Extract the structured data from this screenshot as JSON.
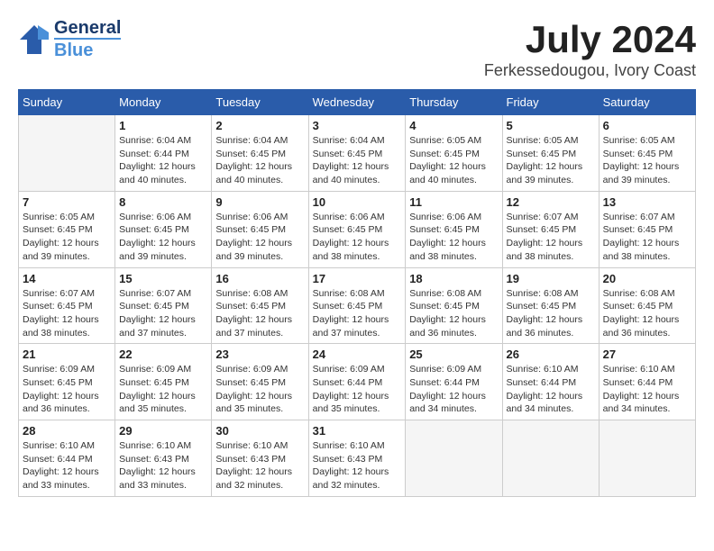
{
  "logo": {
    "general": "General",
    "blue": "Blue"
  },
  "title": {
    "month_year": "July 2024",
    "location": "Ferkessedougou, Ivory Coast"
  },
  "headers": [
    "Sunday",
    "Monday",
    "Tuesday",
    "Wednesday",
    "Thursday",
    "Friday",
    "Saturday"
  ],
  "weeks": [
    [
      {
        "day": "",
        "info": ""
      },
      {
        "day": "1",
        "info": "Sunrise: 6:04 AM\nSunset: 6:44 PM\nDaylight: 12 hours\nand 40 minutes."
      },
      {
        "day": "2",
        "info": "Sunrise: 6:04 AM\nSunset: 6:45 PM\nDaylight: 12 hours\nand 40 minutes."
      },
      {
        "day": "3",
        "info": "Sunrise: 6:04 AM\nSunset: 6:45 PM\nDaylight: 12 hours\nand 40 minutes."
      },
      {
        "day": "4",
        "info": "Sunrise: 6:05 AM\nSunset: 6:45 PM\nDaylight: 12 hours\nand 40 minutes."
      },
      {
        "day": "5",
        "info": "Sunrise: 6:05 AM\nSunset: 6:45 PM\nDaylight: 12 hours\nand 39 minutes."
      },
      {
        "day": "6",
        "info": "Sunrise: 6:05 AM\nSunset: 6:45 PM\nDaylight: 12 hours\nand 39 minutes."
      }
    ],
    [
      {
        "day": "7",
        "info": "Sunrise: 6:05 AM\nSunset: 6:45 PM\nDaylight: 12 hours\nand 39 minutes."
      },
      {
        "day": "8",
        "info": "Sunrise: 6:06 AM\nSunset: 6:45 PM\nDaylight: 12 hours\nand 39 minutes."
      },
      {
        "day": "9",
        "info": "Sunrise: 6:06 AM\nSunset: 6:45 PM\nDaylight: 12 hours\nand 39 minutes."
      },
      {
        "day": "10",
        "info": "Sunrise: 6:06 AM\nSunset: 6:45 PM\nDaylight: 12 hours\nand 38 minutes."
      },
      {
        "day": "11",
        "info": "Sunrise: 6:06 AM\nSunset: 6:45 PM\nDaylight: 12 hours\nand 38 minutes."
      },
      {
        "day": "12",
        "info": "Sunrise: 6:07 AM\nSunset: 6:45 PM\nDaylight: 12 hours\nand 38 minutes."
      },
      {
        "day": "13",
        "info": "Sunrise: 6:07 AM\nSunset: 6:45 PM\nDaylight: 12 hours\nand 38 minutes."
      }
    ],
    [
      {
        "day": "14",
        "info": "Sunrise: 6:07 AM\nSunset: 6:45 PM\nDaylight: 12 hours\nand 38 minutes."
      },
      {
        "day": "15",
        "info": "Sunrise: 6:07 AM\nSunset: 6:45 PM\nDaylight: 12 hours\nand 37 minutes."
      },
      {
        "day": "16",
        "info": "Sunrise: 6:08 AM\nSunset: 6:45 PM\nDaylight: 12 hours\nand 37 minutes."
      },
      {
        "day": "17",
        "info": "Sunrise: 6:08 AM\nSunset: 6:45 PM\nDaylight: 12 hours\nand 37 minutes."
      },
      {
        "day": "18",
        "info": "Sunrise: 6:08 AM\nSunset: 6:45 PM\nDaylight: 12 hours\nand 36 minutes."
      },
      {
        "day": "19",
        "info": "Sunrise: 6:08 AM\nSunset: 6:45 PM\nDaylight: 12 hours\nand 36 minutes."
      },
      {
        "day": "20",
        "info": "Sunrise: 6:08 AM\nSunset: 6:45 PM\nDaylight: 12 hours\nand 36 minutes."
      }
    ],
    [
      {
        "day": "21",
        "info": "Sunrise: 6:09 AM\nSunset: 6:45 PM\nDaylight: 12 hours\nand 36 minutes."
      },
      {
        "day": "22",
        "info": "Sunrise: 6:09 AM\nSunset: 6:45 PM\nDaylight: 12 hours\nand 35 minutes."
      },
      {
        "day": "23",
        "info": "Sunrise: 6:09 AM\nSunset: 6:45 PM\nDaylight: 12 hours\nand 35 minutes."
      },
      {
        "day": "24",
        "info": "Sunrise: 6:09 AM\nSunset: 6:44 PM\nDaylight: 12 hours\nand 35 minutes."
      },
      {
        "day": "25",
        "info": "Sunrise: 6:09 AM\nSunset: 6:44 PM\nDaylight: 12 hours\nand 34 minutes."
      },
      {
        "day": "26",
        "info": "Sunrise: 6:10 AM\nSunset: 6:44 PM\nDaylight: 12 hours\nand 34 minutes."
      },
      {
        "day": "27",
        "info": "Sunrise: 6:10 AM\nSunset: 6:44 PM\nDaylight: 12 hours\nand 34 minutes."
      }
    ],
    [
      {
        "day": "28",
        "info": "Sunrise: 6:10 AM\nSunset: 6:44 PM\nDaylight: 12 hours\nand 33 minutes."
      },
      {
        "day": "29",
        "info": "Sunrise: 6:10 AM\nSunset: 6:43 PM\nDaylight: 12 hours\nand 33 minutes."
      },
      {
        "day": "30",
        "info": "Sunrise: 6:10 AM\nSunset: 6:43 PM\nDaylight: 12 hours\nand 32 minutes."
      },
      {
        "day": "31",
        "info": "Sunrise: 6:10 AM\nSunset: 6:43 PM\nDaylight: 12 hours\nand 32 minutes."
      },
      {
        "day": "",
        "info": ""
      },
      {
        "day": "",
        "info": ""
      },
      {
        "day": "",
        "info": ""
      }
    ]
  ]
}
